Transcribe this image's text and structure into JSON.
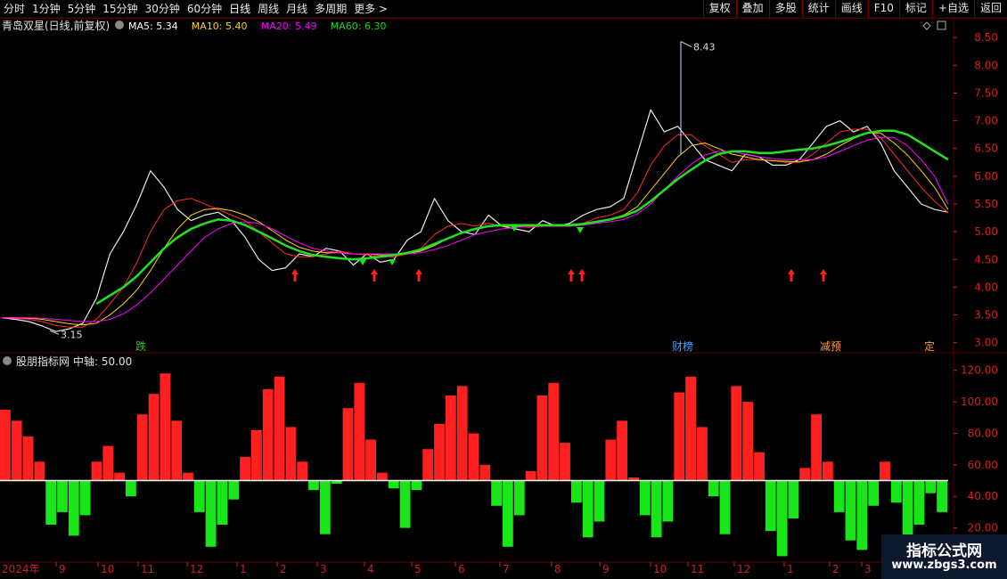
{
  "toolbar": {
    "tabs": [
      "分时",
      "1分钟",
      "5分钟",
      "15分钟",
      "30分钟",
      "60分钟",
      "日线",
      "周线",
      "月线",
      "多周期",
      "更多 >"
    ],
    "active_tab": "日线",
    "buttons": [
      "复权",
      "叠加",
      "多股",
      "统计",
      "画线",
      "F10",
      "标记",
      "+自选",
      "返回"
    ]
  },
  "main_panel": {
    "stock_title": "青岛双星(日线,前复权)",
    "ma_labels": [
      {
        "name": "MA5",
        "value": "5.34",
        "color": "#ffffff"
      },
      {
        "name": "MA10",
        "value": "5.40",
        "color": "#ffd200"
      },
      {
        "name": "MA20",
        "value": "5.49",
        "color": "#ff00ff"
      },
      {
        "name": "MA60",
        "value": "6.30",
        "color": "#19d219"
      }
    ],
    "high_label": "8.43",
    "low_label": "3.15",
    "event_tags": [
      {
        "text": "跌",
        "color": "#19d219"
      },
      {
        "text": "财榜",
        "color": "#3aa0ff"
      },
      {
        "text": "减预",
        "color": "#ff9a3a"
      },
      {
        "text": "定",
        "color": "#ff9a3a"
      }
    ]
  },
  "indicator_panel": {
    "title": "股朋指标网",
    "midline_label": "中轴: 50.00"
  },
  "x_axis": {
    "year": "2024年",
    "months": [
      "9",
      "10",
      "11",
      "12",
      "1",
      "2",
      "3",
      "4",
      "5",
      "6",
      "7",
      "8",
      "9",
      "10",
      "11",
      "12",
      "1",
      "2",
      "3"
    ]
  },
  "watermark": {
    "line1": "指标公式网",
    "line2": "www.zbgs3.com"
  },
  "colors": {
    "up": "#ff2020",
    "down": "#19e619",
    "grid": "#5a0000",
    "axis_text": "#d02020"
  },
  "chart_data": [
    {
      "type": "line",
      "title": "青岛双星(日线,前复权)",
      "ylim": [
        2.85,
        8.6
      ],
      "yticks": [
        3.0,
        3.5,
        4.0,
        4.5,
        5.0,
        5.5,
        6.0,
        6.5,
        7.0,
        7.5,
        8.0,
        8.5
      ],
      "high": 8.43,
      "low": 3.15,
      "series": [
        {
          "name": "price",
          "values": [
            3.45,
            3.42,
            3.38,
            3.3,
            3.2,
            3.25,
            3.35,
            3.8,
            4.6,
            5.0,
            5.5,
            6.1,
            5.8,
            5.4,
            5.2,
            5.3,
            5.35,
            5.2,
            4.9,
            4.5,
            4.3,
            4.35,
            4.6,
            4.55,
            4.7,
            4.65,
            4.4,
            4.6,
            4.45,
            4.5,
            4.85,
            5.0,
            5.6,
            5.2,
            5.0,
            4.95,
            5.3,
            5.1,
            5.05,
            5.0,
            5.2,
            5.1,
            5.15,
            5.3,
            5.4,
            5.45,
            5.6,
            6.4,
            7.2,
            6.8,
            6.9,
            6.6,
            6.3,
            6.2,
            6.1,
            6.4,
            6.35,
            6.2,
            6.2,
            6.3,
            6.6,
            6.9,
            7.0,
            6.8,
            6.9,
            6.6,
            6.1,
            5.8,
            5.5,
            5.4,
            5.35
          ]
        },
        {
          "name": "MA5",
          "values": [
            3.45,
            3.44,
            3.42,
            3.38,
            3.31,
            3.28,
            3.28,
            3.42,
            3.7,
            4.0,
            4.45,
            5.0,
            5.4,
            5.56,
            5.6,
            5.5,
            5.4,
            5.3,
            5.2,
            5.0,
            4.8,
            4.6,
            4.55,
            4.55,
            4.6,
            4.65,
            4.6,
            4.58,
            4.55,
            4.55,
            4.6,
            4.7,
            4.95,
            5.1,
            5.15,
            5.1,
            5.15,
            5.1,
            5.1,
            5.08,
            5.1,
            5.1,
            5.1,
            5.15,
            5.25,
            5.3,
            5.4,
            5.7,
            6.2,
            6.55,
            6.75,
            6.75,
            6.55,
            6.4,
            6.25,
            6.3,
            6.3,
            6.28,
            6.25,
            6.25,
            6.4,
            6.6,
            6.8,
            6.85,
            6.85,
            6.7,
            6.4,
            6.1,
            5.8,
            5.55,
            5.34
          ]
        },
        {
          "name": "MA10",
          "values": [
            3.45,
            3.45,
            3.44,
            3.42,
            3.38,
            3.34,
            3.32,
            3.35,
            3.5,
            3.7,
            3.95,
            4.3,
            4.7,
            5.05,
            5.3,
            5.4,
            5.42,
            5.38,
            5.3,
            5.18,
            5.02,
            4.85,
            4.72,
            4.65,
            4.62,
            4.62,
            4.6,
            4.6,
            4.58,
            4.58,
            4.6,
            4.65,
            4.75,
            4.88,
            4.98,
            5.05,
            5.1,
            5.1,
            5.1,
            5.1,
            5.1,
            5.1,
            5.1,
            5.12,
            5.18,
            5.22,
            5.3,
            5.45,
            5.75,
            6.05,
            6.35,
            6.55,
            6.6,
            6.5,
            6.4,
            6.35,
            6.3,
            6.28,
            6.27,
            6.26,
            6.3,
            6.4,
            6.55,
            6.68,
            6.78,
            6.78,
            6.6,
            6.38,
            6.1,
            5.8,
            5.4
          ]
        },
        {
          "name": "MA20",
          "values": [
            3.45,
            3.45,
            3.45,
            3.44,
            3.42,
            3.4,
            3.38,
            3.38,
            3.42,
            3.52,
            3.68,
            3.9,
            4.15,
            4.4,
            4.65,
            4.9,
            5.05,
            5.15,
            5.18,
            5.15,
            5.05,
            4.92,
            4.8,
            4.7,
            4.65,
            4.62,
            4.6,
            4.6,
            4.6,
            4.6,
            4.6,
            4.62,
            4.68,
            4.75,
            4.85,
            4.95,
            5.0,
            5.05,
            5.08,
            5.1,
            5.1,
            5.1,
            5.1,
            5.12,
            5.15,
            5.18,
            5.22,
            5.32,
            5.5,
            5.75,
            6.0,
            6.22,
            6.38,
            6.45,
            6.45,
            6.4,
            6.35,
            6.32,
            6.3,
            6.3,
            6.3,
            6.35,
            6.45,
            6.55,
            6.65,
            6.7,
            6.7,
            6.55,
            6.3,
            6.0,
            5.49
          ]
        },
        {
          "name": "MA60",
          "values": [
            null,
            null,
            null,
            null,
            null,
            null,
            null,
            3.7,
            3.85,
            4.0,
            4.2,
            4.45,
            4.7,
            4.9,
            5.05,
            5.15,
            5.22,
            5.2,
            5.12,
            5.0,
            4.88,
            4.75,
            4.65,
            4.58,
            4.55,
            4.52,
            4.5,
            4.52,
            4.55,
            4.58,
            4.62,
            4.68,
            4.78,
            4.88,
            4.98,
            5.05,
            5.1,
            5.12,
            5.12,
            5.12,
            5.12,
            5.12,
            5.12,
            5.14,
            5.18,
            5.22,
            5.28,
            5.38,
            5.55,
            5.75,
            5.95,
            6.12,
            6.28,
            6.4,
            6.45,
            6.45,
            6.42,
            6.42,
            6.45,
            6.48,
            6.5,
            6.55,
            6.62,
            6.7,
            6.78,
            6.82,
            6.82,
            6.75,
            6.6,
            6.45,
            6.3
          ]
        }
      ]
    },
    {
      "type": "bar",
      "title": "股朋指标网",
      "ylim": [
        0,
        130
      ],
      "yticks": [
        0.0,
        20.0,
        40.0,
        60.0,
        80.0,
        100.0,
        120.0
      ],
      "midline": 50.0,
      "values": [
        95,
        88,
        78,
        62,
        22,
        30,
        15,
        28,
        62,
        72,
        55,
        40,
        92,
        105,
        118,
        88,
        55,
        30,
        8,
        22,
        38,
        65,
        82,
        108,
        116,
        84,
        62,
        44,
        16,
        48,
        96,
        112,
        76,
        55,
        45,
        20,
        44,
        70,
        86,
        104,
        110,
        80,
        60,
        34,
        8,
        28,
        56,
        104,
        112,
        74,
        36,
        14,
        24,
        76,
        88,
        52,
        28,
        14,
        24,
        106,
        116,
        84,
        40,
        16,
        110,
        100,
        68,
        18,
        2,
        26,
        58,
        92,
        62,
        30,
        12,
        6,
        34,
        62,
        36,
        14,
        22,
        42,
        30
      ]
    }
  ]
}
